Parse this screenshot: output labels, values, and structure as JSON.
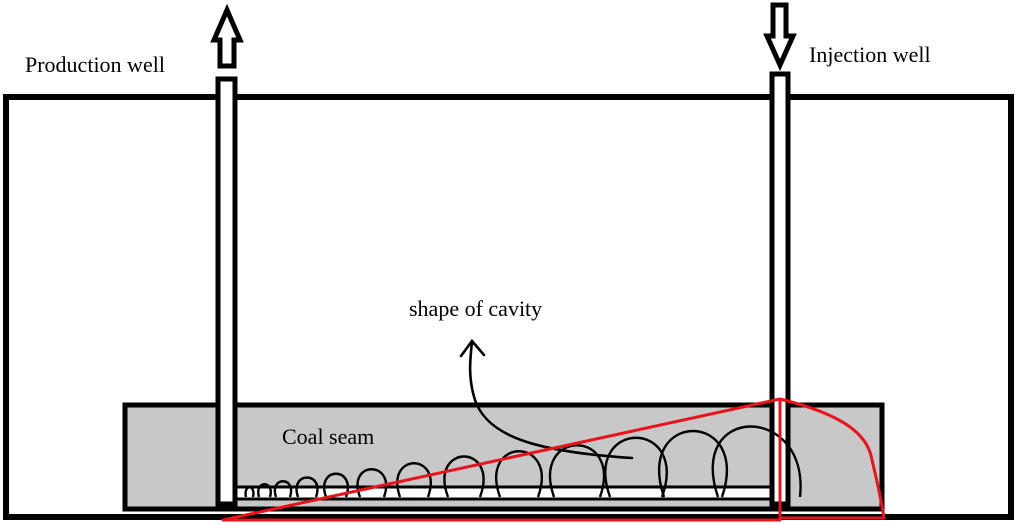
{
  "labels": {
    "production_well": "Production well",
    "injection_well": "Injection well",
    "shape_of_cavity": "shape of cavity",
    "coal_seam": "Coal seam"
  },
  "colors": {
    "background": "#ffffff",
    "outline": "#000000",
    "coal_seam_fill": "#c8c8c8",
    "cavity_outline": "#e8141c"
  },
  "arrows": {
    "production_well": "up",
    "injection_well": "down"
  }
}
